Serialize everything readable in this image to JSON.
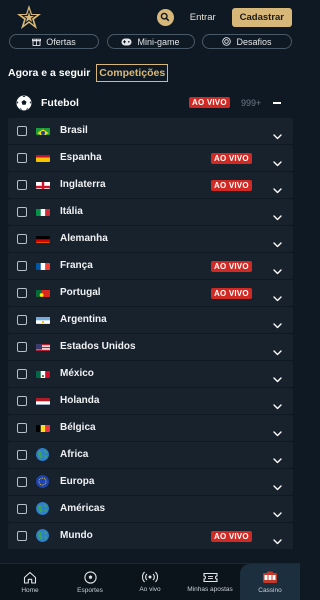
{
  "header": {
    "login_label": "Entrar",
    "register_label": "Cadastrar"
  },
  "pills": [
    {
      "label": "Ofertas",
      "icon": "gift-icon"
    },
    {
      "label": "Mini-game",
      "icon": "gamepad-icon"
    },
    {
      "label": "Desafios",
      "icon": "target-icon"
    }
  ],
  "tabs": {
    "following": "Agora e a seguir",
    "competitions": "Competições"
  },
  "sport": {
    "name": "Futebol",
    "live_label": "AO VIVO",
    "count": "999+"
  },
  "competitions": [
    {
      "name": "Brasil",
      "flag": "brazil-flag-icon",
      "live": false
    },
    {
      "name": "Espanha",
      "flag": "spain-flag-icon",
      "live": true
    },
    {
      "name": "Inglaterra",
      "flag": "england-flag-icon",
      "live": true
    },
    {
      "name": "Itália",
      "flag": "italy-flag-icon",
      "live": false
    },
    {
      "name": "Alemanha",
      "flag": "germany-flag-icon",
      "live": false
    },
    {
      "name": "França",
      "flag": "france-flag-icon",
      "live": true
    },
    {
      "name": "Portugal",
      "flag": "portugal-flag-icon",
      "live": true
    },
    {
      "name": "Argentina",
      "flag": "argentina-flag-icon",
      "live": false
    },
    {
      "name": "Estados Unidos",
      "flag": "usa-flag-icon",
      "live": false
    },
    {
      "name": "México",
      "flag": "mexico-flag-icon",
      "live": false
    },
    {
      "name": "Holanda",
      "flag": "netherlands-flag-icon",
      "live": false
    },
    {
      "name": "Bélgica",
      "flag": "belgium-flag-icon",
      "live": false
    },
    {
      "name": "Africa",
      "flag": "globe-icon",
      "live": false
    },
    {
      "name": "Europa",
      "flag": "eu-flag-icon",
      "live": false
    },
    {
      "name": "Américas",
      "flag": "globe-icon",
      "live": false
    },
    {
      "name": "Mundo",
      "flag": "globe-icon",
      "live": true
    }
  ],
  "live_label": "AO VIVO",
  "bottom_nav": [
    {
      "label": "Home",
      "icon": "home-icon"
    },
    {
      "label": "Esportes",
      "icon": "soccer-ball-icon"
    },
    {
      "label": "Ao vivo",
      "icon": "broadcast-icon"
    },
    {
      "label": "Minhas apostas",
      "icon": "ticket-icon"
    },
    {
      "label": "Cassino",
      "icon": "slot-machine-icon"
    }
  ],
  "colors": {
    "background": "#0f1923",
    "row_background": "#18222d",
    "accent_gold": "#d8b878",
    "live_red": "#d12a24"
  }
}
